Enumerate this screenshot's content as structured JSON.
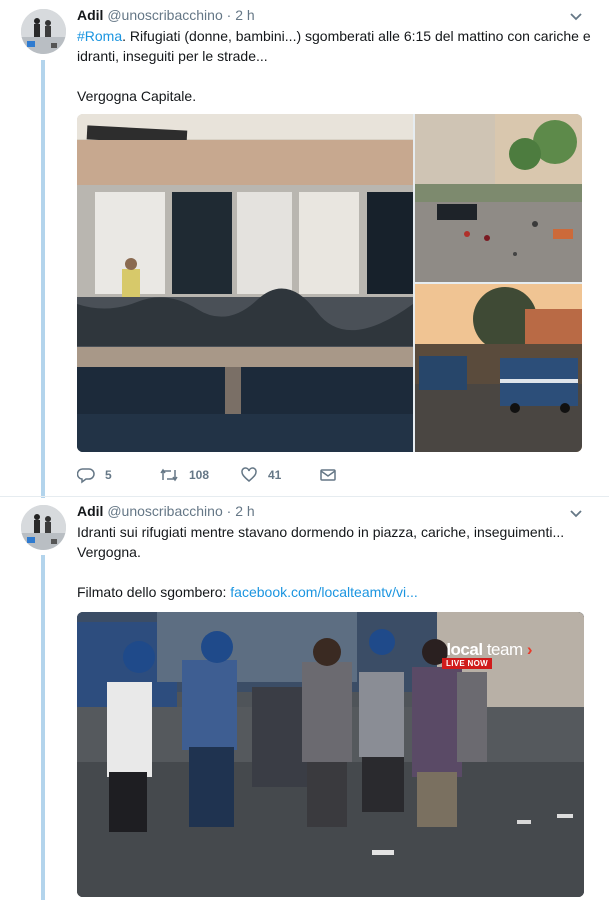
{
  "colors": {
    "accent": "#1b95e0",
    "thread": "#b3d4ec",
    "muted": "#657786",
    "live": "#d01b1b"
  },
  "tweets": [
    {
      "name": "Adil",
      "handle": "@unoscribacchino",
      "separator": "·",
      "time": "2 h",
      "hashtag": "#Roma",
      "text_rest": ". Rifugiati (donne, bambini...) sgomberati alle 6:15 del mattino con cariche e idranti, inseguiti per le strade...",
      "text_line2": "Vergogna Capitale.",
      "replies": "5",
      "retweets": "108",
      "likes": "41"
    },
    {
      "name": "Adil",
      "handle": "@unoscribacchino",
      "separator": "·",
      "time": "2 h",
      "text": "Idranti sui rifugiati mentre stavano dormendo in piazza, cariche, inseguimenti... Vergogna.",
      "link_prefix": "Filmato dello sgombero: ",
      "link": "facebook.com/localteamtv/vi...",
      "video_brand_bold": "local",
      "video_brand_light": "team",
      "video_badge": "LIVE NOW"
    }
  ],
  "icons": [
    "reply-icon",
    "retweet-icon",
    "like-icon",
    "message-icon",
    "chevron-down-icon"
  ]
}
